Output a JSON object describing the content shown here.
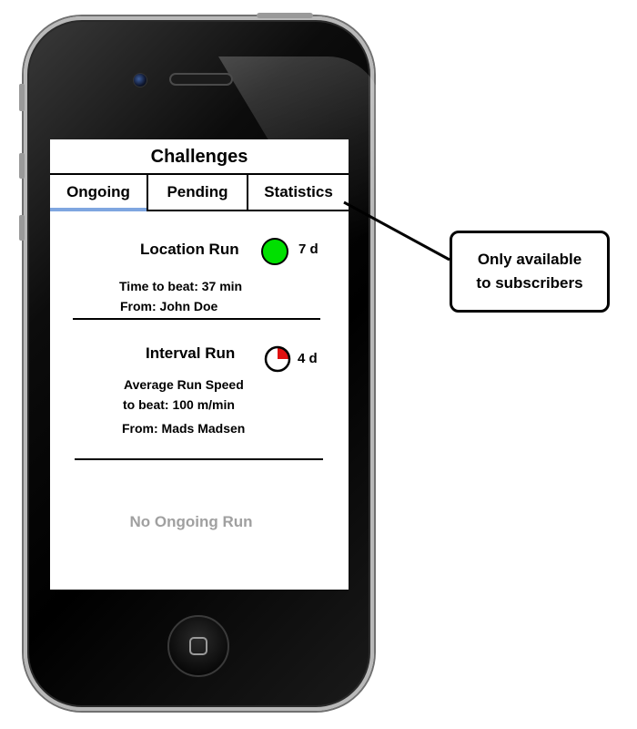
{
  "app": {
    "title": "Challenges"
  },
  "tabs": [
    {
      "label": "Ongoing",
      "active": true
    },
    {
      "label": "Pending",
      "active": false
    },
    {
      "label": "Statistics",
      "active": false
    }
  ],
  "challenges": [
    {
      "name": "Location Run",
      "status_icon": "green-status-circle",
      "status_color": "#00e000",
      "days": "7 d",
      "lines": [
        "Time to beat: 37 min",
        "From: John Doe"
      ]
    },
    {
      "name": "Interval Run",
      "status_icon": "quarter-timer-circle",
      "status_fraction": 0.25,
      "status_color": "#e01010",
      "days": "4 d",
      "lines": [
        "Average Run Speed",
        "to  beat: 100 m/min",
        "From: Mads Madsen"
      ]
    }
  ],
  "empty_message": "No Ongoing Run",
  "callout": {
    "line1": "Only available",
    "line2": "to subscribers"
  },
  "colors": {
    "tab_active_underline": "#7fa6e0",
    "empty_text": "#a0a0a0"
  }
}
